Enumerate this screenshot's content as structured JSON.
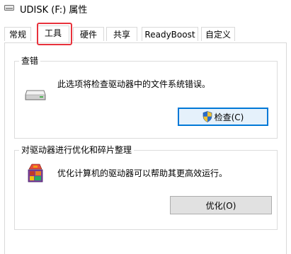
{
  "window": {
    "title": "UDISK (F:) 属性",
    "icon": "drive-icon"
  },
  "tabs": [
    {
      "label": "常规",
      "selected": false
    },
    {
      "label": "工具",
      "selected": true
    },
    {
      "label": "硬件",
      "selected": false
    },
    {
      "label": "共享",
      "selected": false
    },
    {
      "label": "ReadyBoost",
      "selected": false
    },
    {
      "label": "自定义",
      "selected": false
    }
  ],
  "error_check": {
    "title": "查错",
    "description": "此选项将检查驱动器中的文件系统错误。",
    "button_label": "检查(C)",
    "icon": "drive-icon",
    "button_icon": "uac-shield-icon"
  },
  "optimize": {
    "title": "对驱动器进行优化和碎片整理",
    "description": "优化计算机的驱动器可以帮助其更高效运行。",
    "button_label": "优化(O)",
    "icon": "defrag-icon"
  },
  "colors": {
    "highlight_box": "#e8323c",
    "focus_border": "#0078d7",
    "button_bg": "#e1e1e1"
  }
}
